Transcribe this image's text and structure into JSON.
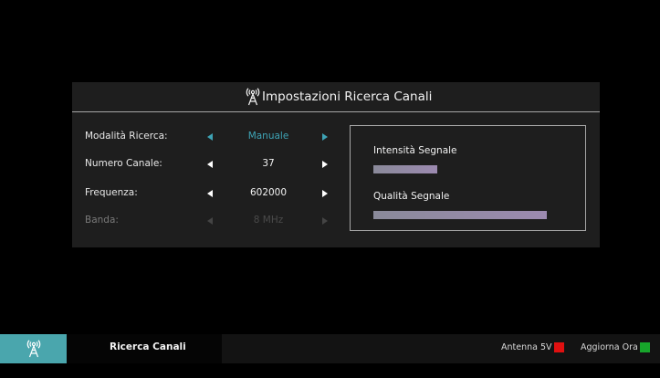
{
  "dialog": {
    "title": "Impostazioni Ricerca Canali",
    "title_icon": "antenna-icon"
  },
  "settings": [
    {
      "label": "Modalità Ricerca:",
      "value": "Manuale",
      "state": "active"
    },
    {
      "label": "Numero Canale:",
      "value": "37",
      "state": "normal"
    },
    {
      "label": "Frequenza:",
      "value": "602000",
      "state": "normal"
    },
    {
      "label": "Banda:",
      "value": "8 MHz",
      "state": "disabled"
    }
  ],
  "signal": {
    "strength_label": "Intensità  Segnale",
    "strength_level": 0.37,
    "quality_label": "Qualità Segnale",
    "quality_level": 1.0
  },
  "bottom_bar": {
    "icon": "antenna-icon",
    "tab_label": "Ricerca Canali",
    "hints": [
      {
        "label": "Antenna 5V",
        "color": "#e01010"
      },
      {
        "label": "Aggiorna Ora",
        "color": "#17a52b"
      }
    ]
  },
  "colors": {
    "accent": "#3ea3b5",
    "tile": "#4aa6ad",
    "dialog_bg": "#1e1e1e"
  }
}
